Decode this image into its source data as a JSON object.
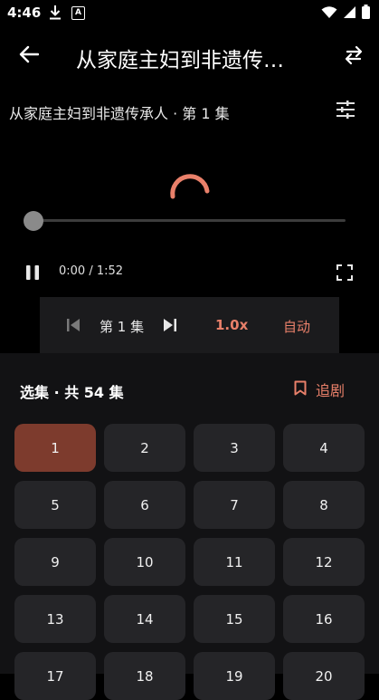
{
  "status_bar": {
    "time": "4:46",
    "a_badge": "A"
  },
  "app_bar": {
    "title": "从家庭主妇到非遗传…"
  },
  "player": {
    "episode_title": "从家庭主妇到非遗传承人 · 第 1 集",
    "current_time": "0:00",
    "duration": "1:52",
    "timecode_sep": " / ",
    "progress": 0,
    "controls": {
      "episode_label": "第 1 集",
      "speed": "1.0x",
      "auto_label": "自动"
    }
  },
  "episodes": {
    "header": "选集 · 共 54 集",
    "follow_label": "追剧",
    "active": "1",
    "items": [
      "1",
      "2",
      "3",
      "4",
      "5",
      "6",
      "7",
      "8",
      "9",
      "10",
      "11",
      "12",
      "13",
      "14",
      "15",
      "16",
      "17",
      "18",
      "19",
      "20"
    ]
  },
  "colors": {
    "accent": "#e9806a",
    "active_cell": "#7d3b2d",
    "cell": "#252528",
    "sheet": "#121214"
  }
}
